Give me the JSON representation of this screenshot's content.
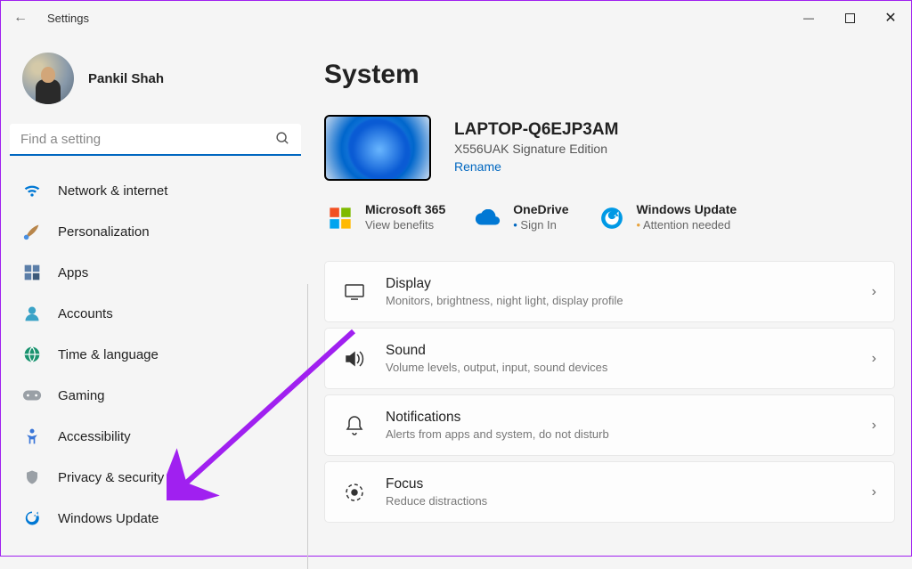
{
  "titlebar": {
    "title": "Settings"
  },
  "user": {
    "name": "Pankil Shah"
  },
  "search": {
    "placeholder": "Find a setting"
  },
  "sidebar": {
    "items": [
      {
        "label": "Network & internet",
        "icon": "wifi-icon"
      },
      {
        "label": "Personalization",
        "icon": "brush-icon"
      },
      {
        "label": "Apps",
        "icon": "apps-icon"
      },
      {
        "label": "Accounts",
        "icon": "person-icon"
      },
      {
        "label": "Time & language",
        "icon": "globe-icon"
      },
      {
        "label": "Gaming",
        "icon": "gamepad-icon"
      },
      {
        "label": "Accessibility",
        "icon": "accessibility-icon"
      },
      {
        "label": "Privacy & security",
        "icon": "shield-icon"
      },
      {
        "label": "Windows Update",
        "icon": "update-icon"
      }
    ]
  },
  "page": {
    "title": "System"
  },
  "device": {
    "name": "LAPTOP-Q6EJP3AM",
    "model": "X556UAK Signature Edition",
    "rename_label": "Rename"
  },
  "cloud": {
    "m365": {
      "title": "Microsoft 365",
      "sub": "View benefits"
    },
    "onedrive": {
      "title": "OneDrive",
      "sub": "Sign In"
    },
    "update": {
      "title": "Windows Update",
      "sub": "Attention needed"
    }
  },
  "settings": [
    {
      "title": "Display",
      "sub": "Monitors, brightness, night light, display profile",
      "icon": "display-icon"
    },
    {
      "title": "Sound",
      "sub": "Volume levels, output, input, sound devices",
      "icon": "sound-icon"
    },
    {
      "title": "Notifications",
      "sub": "Alerts from apps and system, do not disturb",
      "icon": "bell-icon"
    },
    {
      "title": "Focus",
      "sub": "Reduce distractions",
      "icon": "focus-icon"
    }
  ]
}
